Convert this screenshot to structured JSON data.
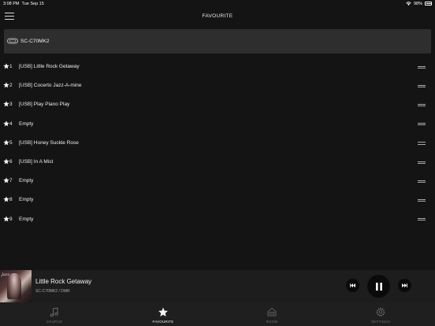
{
  "status": {
    "time": "3:08 PM",
    "date": "Tue Sep 15",
    "battery": "98%"
  },
  "header": {
    "title": "FAVOURITE"
  },
  "device": {
    "name": "SC-C70MK2"
  },
  "favourites": [
    {
      "num": "1",
      "label": "[USB] Little Rock Getaway"
    },
    {
      "num": "2",
      "label": "[USB] Cocerto Jazz-A-mine"
    },
    {
      "num": "3",
      "label": "[USB] Play Piano Play"
    },
    {
      "num": "4",
      "label": "Empty"
    },
    {
      "num": "5",
      "label": "[USB] Honey Suckle Rose"
    },
    {
      "num": "6",
      "label": "[USB] In A Mist"
    },
    {
      "num": "7",
      "label": "Empty"
    },
    {
      "num": "8",
      "label": "Empty"
    },
    {
      "num": "9",
      "label": "Empty"
    }
  ],
  "now_playing": {
    "title": "Little Rock Getaway",
    "source": "SC-C70MK2 / DMR",
    "art_text": "Jazz"
  },
  "tabs": [
    {
      "label": "SOURCE",
      "icon": "music-note-icon",
      "active": false
    },
    {
      "label": "FAVOURITE",
      "icon": "star-icon",
      "active": true
    },
    {
      "label": "ROOM",
      "icon": "room-icon",
      "active": false
    },
    {
      "label": "SETTINGS",
      "icon": "gear-icon",
      "active": false
    }
  ]
}
